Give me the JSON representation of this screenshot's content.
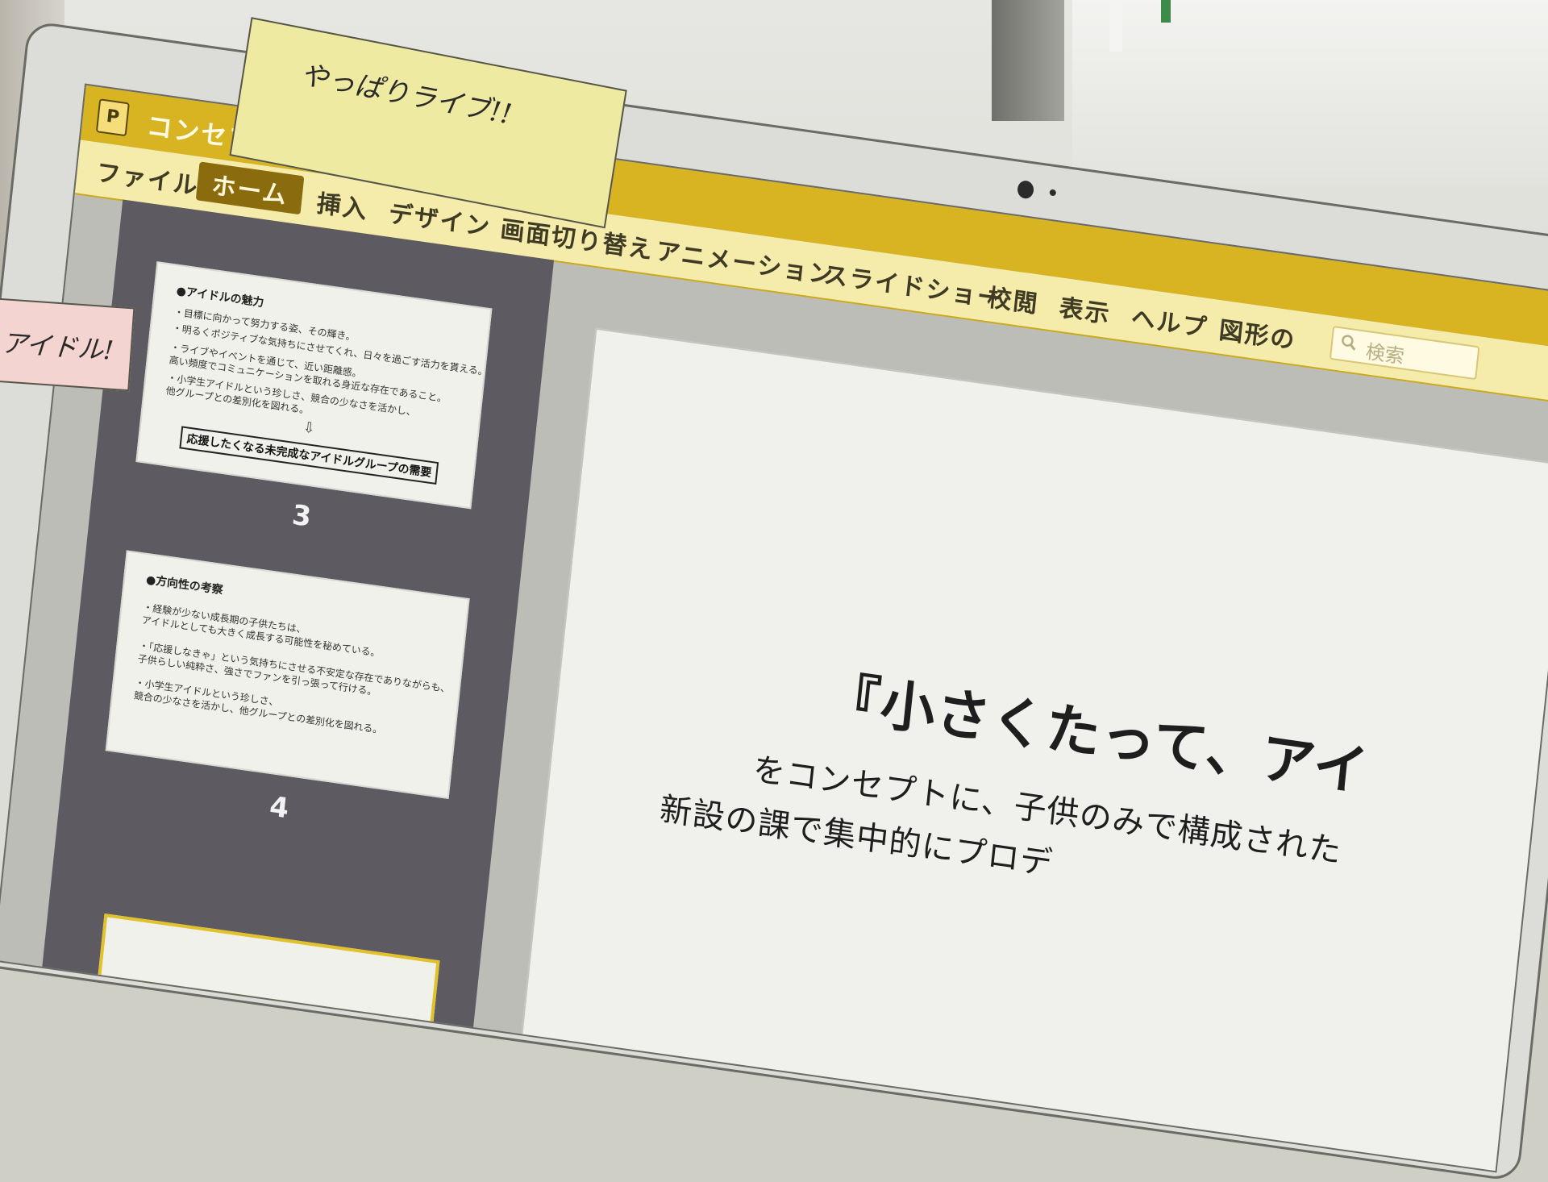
{
  "app": {
    "icon_letter": "P",
    "document_title": "コンセプト"
  },
  "ribbon": {
    "tabs": [
      {
        "label": "ファイル",
        "active": false
      },
      {
        "label": "ホーム",
        "active": true
      },
      {
        "label": "挿入",
        "active": false
      },
      {
        "label": "デザイン",
        "active": false
      },
      {
        "label": "画面切り替え",
        "active": false
      },
      {
        "label": "アニメーション",
        "active": false
      },
      {
        "label": "スライドショー",
        "active": false
      },
      {
        "label": "校閲",
        "active": false
      },
      {
        "label": "表示",
        "active": false
      },
      {
        "label": "ヘルプ",
        "active": false
      },
      {
        "label": "図形の",
        "active": false
      }
    ],
    "search_placeholder": "検索"
  },
  "slides_panel": {
    "slide3": {
      "number": "3",
      "heading": "●アイドルの魅力",
      "lines": [
        "・目標に向かって努力する姿、その輝き。",
        "・明るくポジティブな気持ちにさせてくれ、日々を過ごす活力を貰える。",
        "・ライブやイベントを通じて、近い距離感。",
        "  高い頻度でコミュニケーションを取れる身近な存在であること。",
        "・小学生アイドルという珍しさ、競合の少なさを活かし、",
        "  他グループとの差別化を図れる。"
      ],
      "arrow": "⇩",
      "boxed": "応援したくなる未完成なアイドルグループの需要"
    },
    "slide4": {
      "number": "4",
      "heading": "●方向性の考察",
      "lines": [
        "・経験が少ない成長期の子供たちは、",
        "  アイドルとしても大きく成長する可能性を秘めている。",
        "・「応援しなきゃ」という気持ちにさせる不安定な存在でありながらも、",
        "  子供らしい純粋さ、強さでファンを引っ張って行ける。",
        "・小学生アイドルという珍しさ、",
        "  競合の少なさを活かし、他グループとの差別化を図れる。"
      ]
    }
  },
  "main_slide": {
    "title": "『小さくたって、アイ",
    "body_line_1": "をコンセプトに、子供のみで構成された",
    "body_line_2": "新設の課で集中的にプロデ"
  },
  "sticky_notes": {
    "yellow": "やっぱりライブ!!",
    "pink": "アイドル!"
  }
}
